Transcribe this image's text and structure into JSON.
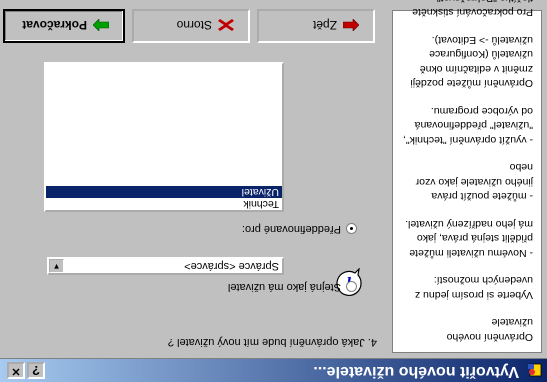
{
  "window": {
    "title": "Vytvořit nového uživatele...",
    "help_label": "?",
    "close_label": "✕"
  },
  "sidebar": {
    "paragraphs": [
      "Oprávnění nového uživatele",
      "Vyberte si prosím jednu z uvedených možností:",
      "- Novému uživateli můžete přidělit stejná práva, jako má jeho nadřízený uživatel.",
      "- můžete použít práva jiného uživatele jako vzor nebo",
      "- využít oprávnění \"technik\", \"uživatel\" předdefinovaná od výrobce programu.",
      "Oprávnění můžete později změnit v editačním okně uživatelů (Konfigurace uživatelů -> Editovat).",
      "Pro pokračování stiskněte tlačítko \"Pokračovat\"."
    ]
  },
  "form": {
    "question": "4. Jaká oprávnění bude mít nový uživatel ?",
    "option_same_as_me": "Stejná jako má uživatel",
    "selected_user": "Správce <správce>",
    "option_predefined": "Předdefinované pro:",
    "predefined_list": [
      "Technik",
      "Uživatel"
    ],
    "selected_predefined": "Uživatel"
  },
  "buttons": {
    "back": "Zpět",
    "cancel": "Storno",
    "continue": "Pokračovat"
  },
  "icons": {
    "app": "user-wizard-icon",
    "info": "info-icon",
    "back": "arrow-left-icon",
    "cancel": "cross-icon",
    "continue": "arrow-right-icon"
  },
  "colors": {
    "title_start": "#0a246a",
    "title_end": "#a6caf0",
    "face": "#c0c0c0",
    "selection": "#0a246a",
    "back_arrow": "#c00000",
    "continue_arrow": "#00a000"
  }
}
